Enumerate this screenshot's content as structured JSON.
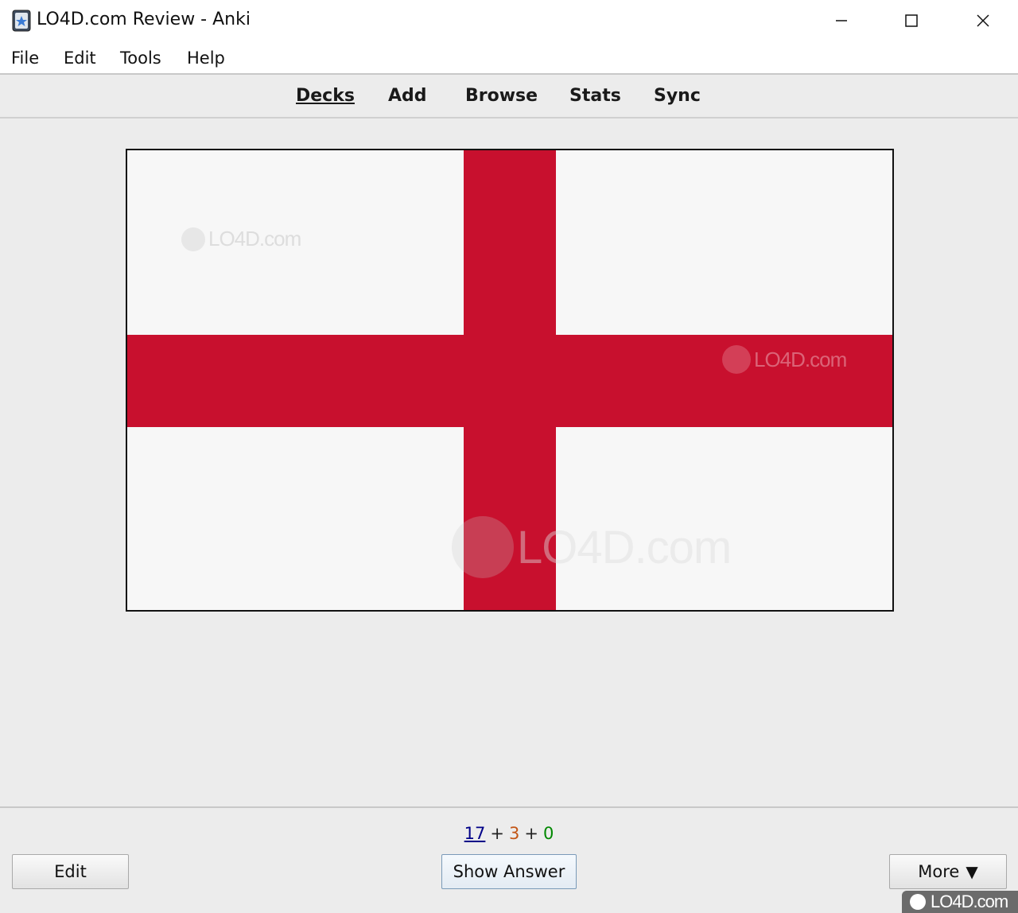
{
  "window": {
    "title": "LO4D.com Review - Anki"
  },
  "menu": {
    "items": [
      "File",
      "Edit",
      "Tools",
      "Help"
    ]
  },
  "toolbar": {
    "decks": "Decks",
    "add": "Add",
    "browse": "Browse",
    "stats": "Stats",
    "sync": "Sync"
  },
  "card": {
    "image_description_icon": "england-flag-icon",
    "watermark_small": "LO4D.com",
    "watermark_mid": "LO4D.com",
    "watermark_large": "LO4D.com"
  },
  "bottom": {
    "count_new": "17",
    "count_learn": "3",
    "count_review": "0",
    "plus": "+",
    "edit_label": "Edit",
    "show_answer_label": "Show Answer",
    "more_label": "More",
    "more_arrow": "▼"
  },
  "branding": {
    "corner_logo": "LO4D.com"
  },
  "colors": {
    "flag_red": "#c8102e",
    "flag_white": "#f7f7f7",
    "count_new": "#000088",
    "count_learn": "#c35617",
    "count_review": "#008800"
  }
}
